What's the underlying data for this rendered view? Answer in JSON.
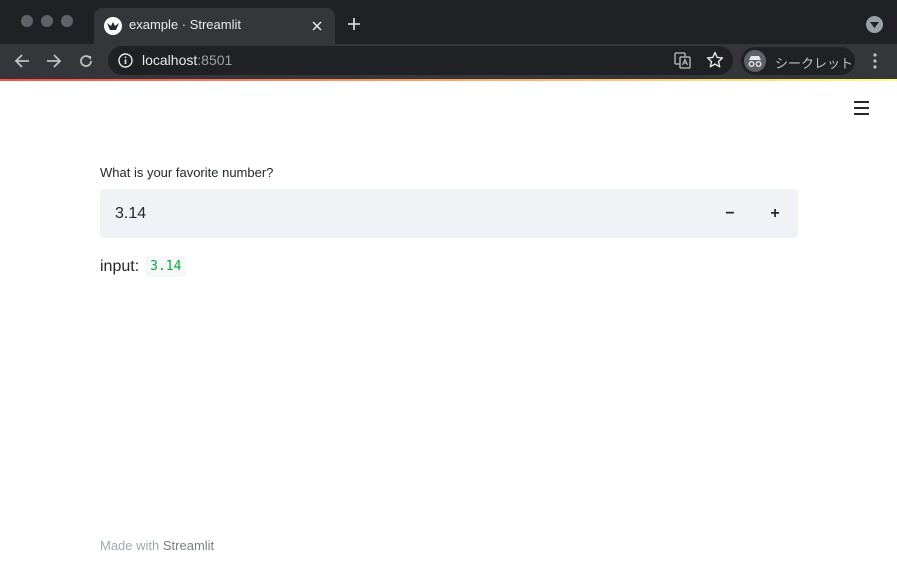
{
  "browser": {
    "tab_title": "example · Streamlit",
    "url_host": "localhost",
    "url_port": ":8501",
    "incognito_label": "シークレット"
  },
  "app": {
    "number_input": {
      "label": "What is your favorite number?",
      "value": "3.14",
      "minus_label": "−",
      "plus_label": "+"
    },
    "output": {
      "prefix": "input:",
      "code_value": "3.14"
    },
    "footer": {
      "text": "Made with ",
      "link": "Streamlit"
    }
  },
  "colors": {
    "accent_gradient_start": "#ff4b4b",
    "accent_gradient_end": "#fffd80",
    "code_green": "#09ab3b",
    "input_background": "#f0f2f6"
  }
}
